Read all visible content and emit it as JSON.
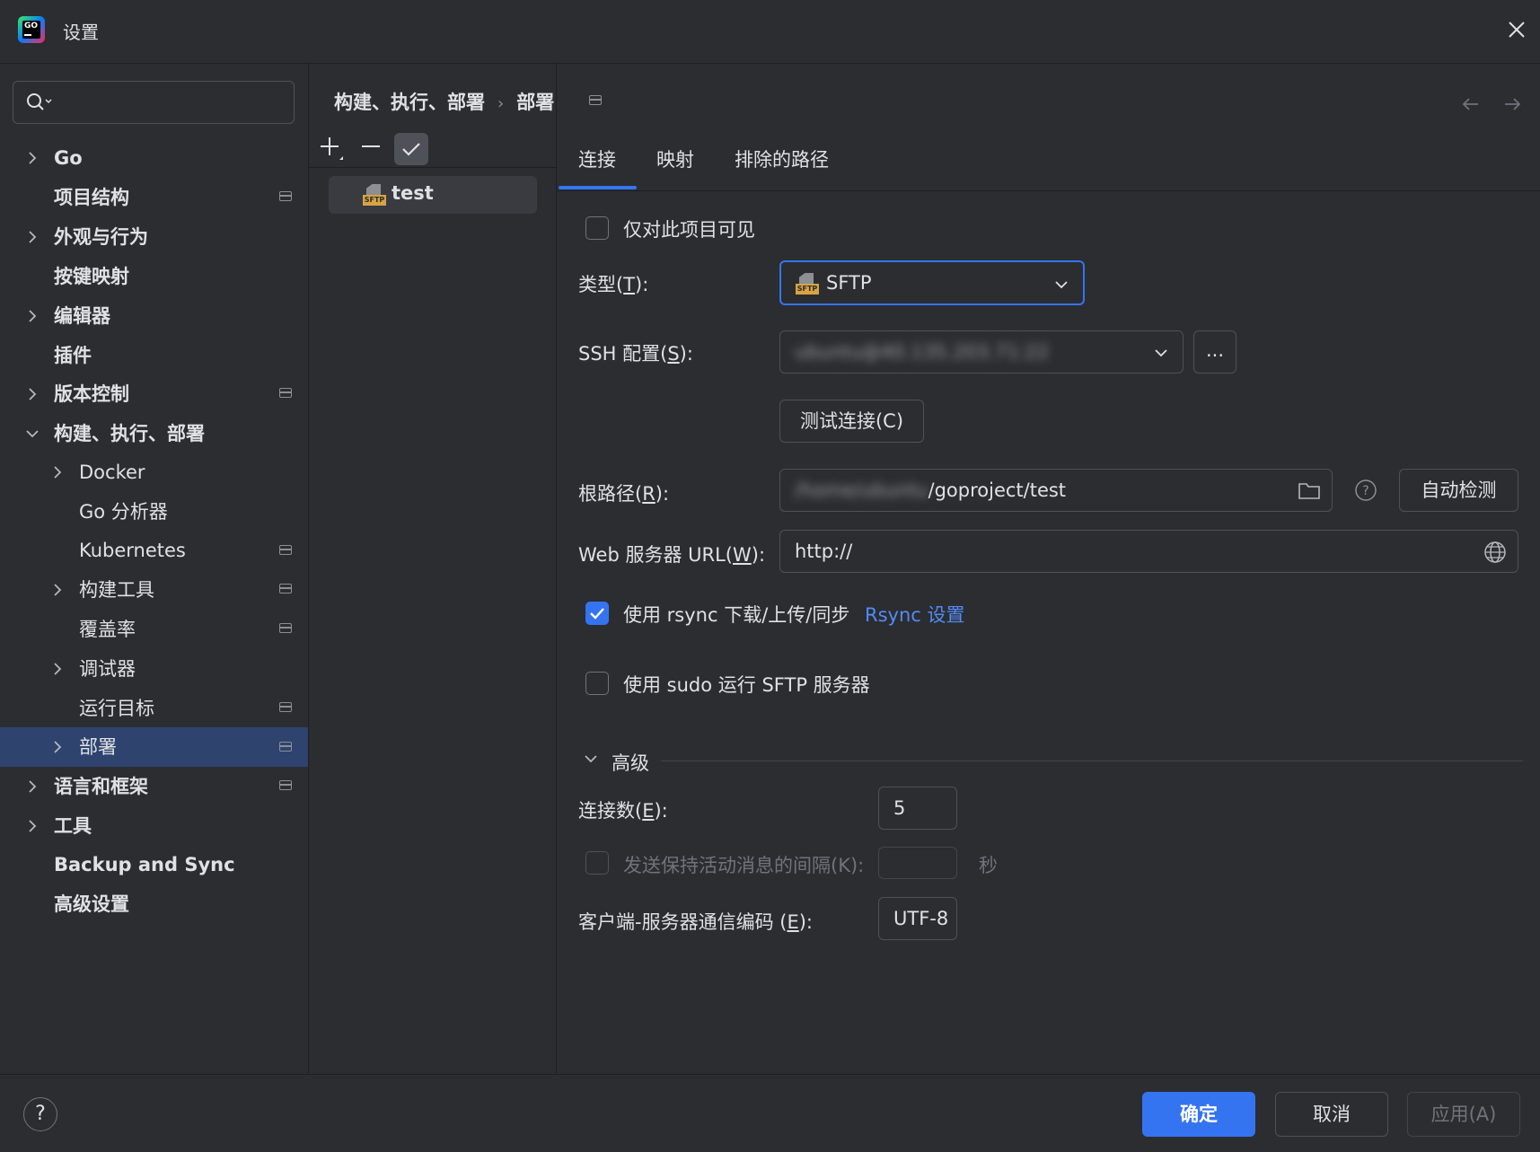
{
  "window": {
    "title": "设置"
  },
  "sidebar": {
    "search": {
      "placeholder": ""
    },
    "items": [
      {
        "label": "Go"
      },
      {
        "label": "项目结构"
      },
      {
        "label": "外观与行为"
      },
      {
        "label": "按键映射"
      },
      {
        "label": "编辑器"
      },
      {
        "label": "插件"
      },
      {
        "label": "版本控制"
      },
      {
        "label": "构建、执行、部署"
      },
      {
        "label": "Docker"
      },
      {
        "label": "Go 分析器"
      },
      {
        "label": "Kubernetes"
      },
      {
        "label": "构建工具"
      },
      {
        "label": "覆盖率"
      },
      {
        "label": "调试器"
      },
      {
        "label": "运行目标"
      },
      {
        "label": "部署"
      },
      {
        "label": "语言和框架"
      },
      {
        "label": "工具"
      },
      {
        "label": "Backup and Sync"
      },
      {
        "label": "高级设置"
      }
    ]
  },
  "breadcrumb": {
    "parent": "构建、执行、部署",
    "separator": "›",
    "current": "部署"
  },
  "servers": [
    {
      "name": "test",
      "icon_tag": "SFTP"
    }
  ],
  "tabs": [
    {
      "label": "连接"
    },
    {
      "label": "映射"
    },
    {
      "label": "排除的路径"
    }
  ],
  "form": {
    "visible_only_project": {
      "label": "仅对此项目可见",
      "checked": false
    },
    "type": {
      "label_pre": "类型(",
      "label_key": "T",
      "label_post": "):",
      "value": "SFTP"
    },
    "ssh": {
      "label_pre": "SSH 配置(",
      "label_key": "S",
      "label_post": "):",
      "value": "ubuntu@40.135.203.71:22",
      "browse": "..."
    },
    "test_connection": "测试连接(C)",
    "root_path": {
      "label_pre": "根路径(",
      "label_key": "R",
      "label_post": "):",
      "blurred": "/home/ubuntu",
      "value": "/goproject/test",
      "auto_detect": "自动检测"
    },
    "web_url": {
      "label_pre": "Web 服务器 URL(",
      "label_key": "W",
      "label_post": "):",
      "value": "http://"
    },
    "rsync": {
      "label": "使用 rsync 下载/上传/同步",
      "checked": true,
      "link": "Rsync 设置"
    },
    "sudo": {
      "label": "使用 sudo 运行 SFTP 服务器",
      "checked": false
    },
    "advanced": {
      "title": "高级"
    },
    "connections": {
      "label_pre": "连接数(",
      "label_key": "E",
      "label_post": "):",
      "value": "5"
    },
    "keepalive": {
      "label": "发送保持活动消息的间隔(K):",
      "value": "",
      "unit": "秒"
    },
    "encoding": {
      "label_pre": "客户端-服务器通信编码 (",
      "label_key": "E",
      "label_post": "):",
      "value": "UTF-8"
    }
  },
  "footer": {
    "help": "?",
    "ok": "确定",
    "cancel": "取消",
    "apply": "应用(A)"
  },
  "colors": {
    "accent": "#3574f0",
    "selection": "#2e436e",
    "link": "#548af7"
  }
}
